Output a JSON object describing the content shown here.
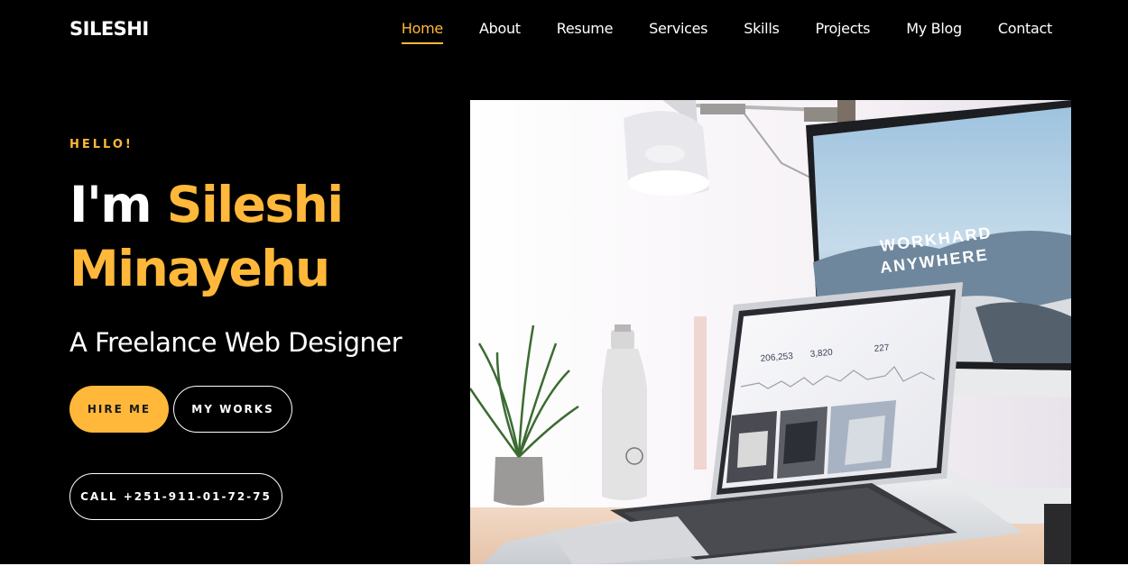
{
  "header": {
    "logo": "SILESHI",
    "nav": [
      "Home",
      "About",
      "Resume",
      "Services",
      "Skills",
      "Projects",
      "My Blog",
      "Contact"
    ],
    "active_index": 0
  },
  "hero": {
    "greeting": "HELLO!",
    "intro": "I'm ",
    "first_name": "Sileshi",
    "last_name": "Minayehu",
    "subtitle": "A Freelance Web Designer",
    "hire_button": "HIRE ME",
    "works_button": "MY WORKS",
    "call_button": "CALL +251-911-01-72-75"
  },
  "photo": {
    "monitor_line1": "WORKHARD",
    "monitor_line2": "ANYWHERE",
    "stat1": "206,253",
    "stat2": "3,820",
    "stat3": "227"
  },
  "colors": {
    "accent": "#ffb839",
    "background": "#000000",
    "text": "#ffffff"
  }
}
